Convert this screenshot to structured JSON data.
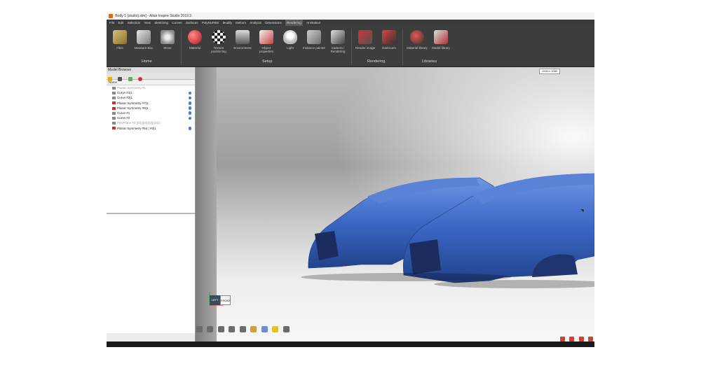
{
  "window": {
    "title": "Body 1 (studio).stm] - Altair Inspire Studio 2019.3"
  },
  "menu": [
    "File",
    "Edit",
    "Selection",
    "View",
    "Sketching",
    "Curves",
    "Surfaces",
    "PolyNURBS",
    "Modify",
    "Deform",
    "Analysis",
    "Dimensions",
    "Rendering",
    "Animation"
  ],
  "menu_active": "Rendering",
  "ribbon": {
    "tools": [
      {
        "label": "Files",
        "icon": "files-icon"
      },
      {
        "label": "Measure Box",
        "icon": "measure-box-icon"
      },
      {
        "label": "Move",
        "icon": "move-icon"
      },
      {
        "label": "Material",
        "icon": "material-icon"
      },
      {
        "label": "Texture positioning",
        "icon": "texture-icon"
      },
      {
        "label": "Environment",
        "icon": "environment-icon"
      },
      {
        "label": "Object properties",
        "icon": "object-properties-icon"
      },
      {
        "label": "Light",
        "icon": "light-icon"
      },
      {
        "label": "Instance painter",
        "icon": "instance-painter-icon"
      },
      {
        "label": "Camera / Rendering",
        "icon": "camera-icon"
      },
      {
        "label": "Render image",
        "icon": "render-image-icon"
      },
      {
        "label": "Darkroom",
        "icon": "darkroom-icon"
      },
      {
        "label": "Material library",
        "icon": "material-library-icon"
      },
      {
        "label": "Model library",
        "icon": "model-library-icon"
      }
    ],
    "groups": {
      "home": "Home",
      "setup": "Setup",
      "rendering": "Rendering",
      "libraries": "Libraries"
    }
  },
  "model_browser": {
    "title": "Model Browser",
    "column_name": "Name",
    "items": [
      {
        "label": "Planar Symmetry #1",
        "dim": true,
        "visible": false
      },
      {
        "label": "Curve #1|1",
        "dim": false,
        "visible": true
      },
      {
        "label": "Curve #2|1",
        "dim": false,
        "visible": true
      },
      {
        "label": "Planar Symmetry #7|1",
        "dim": false,
        "visible": true
      },
      {
        "label": "Planar Symmetry #8|1",
        "dim": false,
        "visible": true
      },
      {
        "label": "Curve #1",
        "dim": false,
        "visible": true
      },
      {
        "label": "Curve #2",
        "dim": false,
        "visible": true
      },
      {
        "label": "PolyPlane #3 (|0|)(|0|)(|0|)(|0|)1",
        "dim": true,
        "visible": false
      },
      {
        "label": "Planar Symmetry #54 | #0|1",
        "dim": false,
        "visible": true
      }
    ]
  },
  "viewport": {
    "resolution_badge": "1920 x 1080",
    "view_cube_left": "LEFT",
    "view_cube_front": "FRONT",
    "car_color": "#3a66c4"
  }
}
